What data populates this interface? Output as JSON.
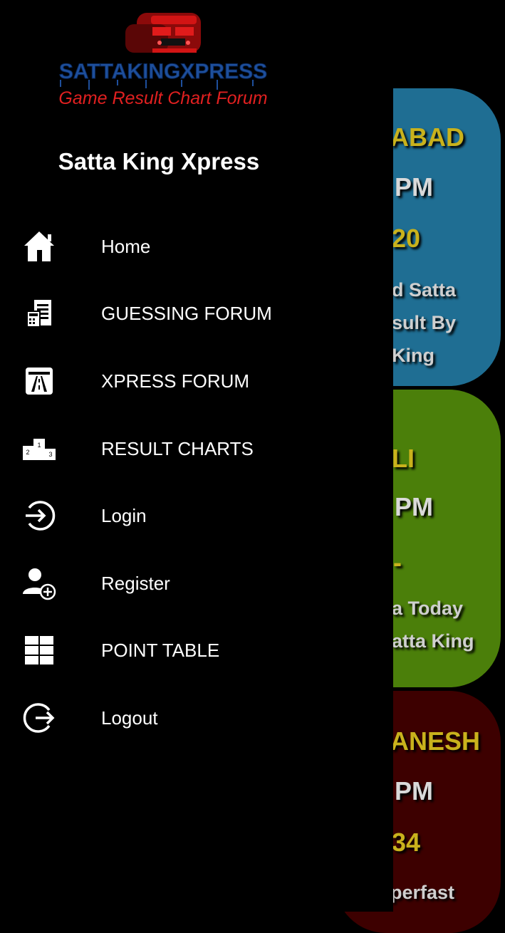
{
  "drawer": {
    "logo": {
      "brand_text": "SATTAKINGXPRESS",
      "tagline": "Game Result Chart Forum"
    },
    "app_title": "Satta King Xpress",
    "menu": [
      {
        "label": "Home",
        "icon": "home-icon"
      },
      {
        "label": "GUESSING FORUM",
        "icon": "calculator-document-icon"
      },
      {
        "label": "XPRESS FORUM",
        "icon": "highway-icon"
      },
      {
        "label": "RESULT CHARTS",
        "icon": "podium-icon"
      },
      {
        "label": "Login",
        "icon": "login-icon"
      },
      {
        "label": "Register",
        "icon": "add-user-icon"
      },
      {
        "label": "POINT TABLE",
        "icon": "grid-icon"
      },
      {
        "label": "Logout",
        "icon": "logout-icon"
      }
    ]
  },
  "background_cards": [
    {
      "title": "ABAD",
      "time": "PM",
      "number": "20",
      "desc1": "d Satta",
      "desc2": "sult By",
      "desc3": "King",
      "color": "#1f6e93"
    },
    {
      "title": "LI",
      "time": "PM",
      "number": "-",
      "desc1": "a Today",
      "desc2": "atta King",
      "color": "#4b7f0a"
    },
    {
      "title": "ANESH",
      "time": "PM",
      "number": "34",
      "desc1": "perfast",
      "color": "#3d0000"
    }
  ]
}
